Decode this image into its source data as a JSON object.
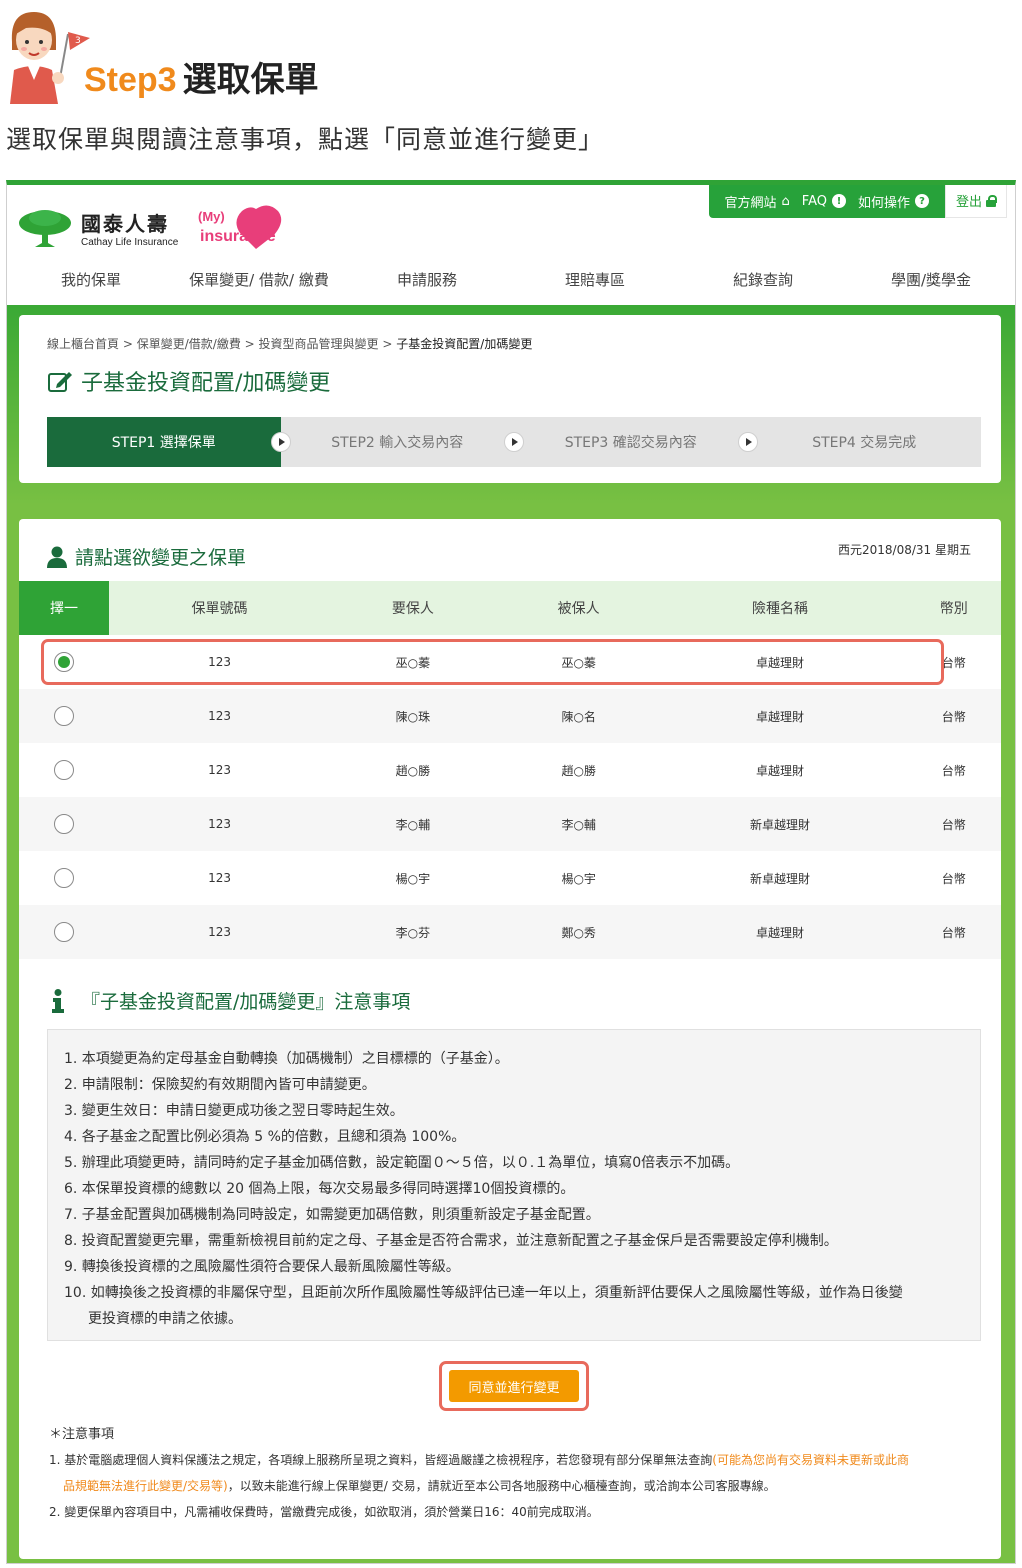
{
  "tutorial": {
    "mascot_badge": "3",
    "step_num": "Step3",
    "step_text": "選取保單",
    "subtitle": "選取保單與閱讀注意事項，點選「同意並進行變更」"
  },
  "topbar": {
    "official": "官方網站",
    "faq": "FAQ",
    "howto": "如何操作",
    "logout": "登出"
  },
  "logo": {
    "cn": "國泰人壽",
    "en": "Cathay Life Insurance",
    "my_insurance": "My insurance"
  },
  "nav": [
    "我的保單",
    "保單變更/ 借款/ 繳費",
    "申請服務",
    "理賠專區",
    "紀錄查詢",
    "學團/獎學金"
  ],
  "breadcrumb": [
    "線上櫃台首頁",
    "保單變更/借款/繳費",
    "投資型商品管理與變更",
    "子基金投資配置/加碼變更"
  ],
  "breadcrumb_sep": ">",
  "page_title": "子基金投資配置/加碼變更",
  "steps": [
    "STEP1 選擇保單",
    "STEP2 輸入交易內容",
    "STEP3 確認交易內容",
    "STEP4 交易完成"
  ],
  "section_title": "請點選欲變更之保單",
  "date": "西元2018/08/31 星期五",
  "table": {
    "headers": [
      "擇一",
      "保單號碼",
      "要保人",
      "被保人",
      "險種名稱",
      "幣別"
    ],
    "rows": [
      {
        "policy": "123",
        "holder": "巫○蓁",
        "insured": "巫○蓁",
        "product": "卓越理財",
        "currency": "台幣",
        "selected": true
      },
      {
        "policy": "123",
        "holder": "陳○珠",
        "insured": "陳○名",
        "product": "卓越理財",
        "currency": "台幣",
        "selected": false
      },
      {
        "policy": "123",
        "holder": "趙○勝",
        "insured": "趙○勝",
        "product": "卓越理財",
        "currency": "台幣",
        "selected": false
      },
      {
        "policy": "123",
        "holder": "李○輔",
        "insured": "李○輔",
        "product": "新卓越理財",
        "currency": "台幣",
        "selected": false
      },
      {
        "policy": "123",
        "holder": "楊○宇",
        "insured": "楊○宇",
        "product": "新卓越理財",
        "currency": "台幣",
        "selected": false
      },
      {
        "policy": "123",
        "holder": "李○芬",
        "insured": "鄭○秀",
        "product": "卓越理財",
        "currency": "台幣",
        "selected": false
      }
    ]
  },
  "notes_title": "『子基金投資配置/加碼變更』注意事項",
  "notes": [
    "1. 本項變更為約定母基金自動轉換（加碼機制）之目標標的（子基金）。",
    "2. 申請限制：保險契約有效期間內皆可申請變更。",
    "3. 變更生效日：申請日變更成功後之翌日零時起生效。",
    "4. 各子基金之配置比例必須為 5 %的倍數，且總和須為 100%。",
    "5. 辦理此項變更時，請同時約定子基金加碼倍數，設定範圍０～５倍，以０.１為單位，填寫0倍表示不加碼。",
    "6. 本保單投資標的總數以 20 個為上限，每次交易最多得同時選擇10個投資標的。",
    "7. 子基金配置與加碼機制為同時設定，如需變更加碼倍數，則須重新設定子基金配置。",
    "8. 投資配置變更完畢，需重新檢視目前約定之母、子基金是否符合需求，並注意新配置之子基金保戶是否需要設定停利機制。",
    "9. 轉換後投資標的之風險屬性須符合要保人最新風險屬性等級。"
  ],
  "note10_a": "10. 如轉換後之投資標的非屬保守型，且距前次所作風險屬性等級評估已達一年以上，須重新評估要保人之風險屬性等級，並作為日後變",
  "note10_b": "更投資標的申請之依據。",
  "agree_button": "同意並進行變更",
  "footer": {
    "title": "＊注意事項",
    "item1_a": "1. 基於電腦處理個人資料保護法之規定，各項線上服務所呈現之資料，皆經過嚴謹之檢視程序，若您發現有部分保單無法查詢",
    "item1_orange_a": "(可能為您尚有交易資料未更新或此商",
    "item1_orange_b": "品規範無法進行此變更/交易等)",
    "item1_b": "，以致未能進行線上保單變更/ 交易，請就近至本公司各地服務中心櫃檯查詢，或洽詢本公司客服專線。",
    "item2": "2. 變更保單內容項目中，凡需補收保費時，當繳費完成後，如欲取消，須於營業日16：40前完成取消。"
  },
  "colors": {
    "brand_green": "#2fa336",
    "dark_green": "#1a6b3c",
    "orange": "#f08a1c",
    "button_orange": "#f39a00",
    "highlight_red": "#e86a5c"
  }
}
